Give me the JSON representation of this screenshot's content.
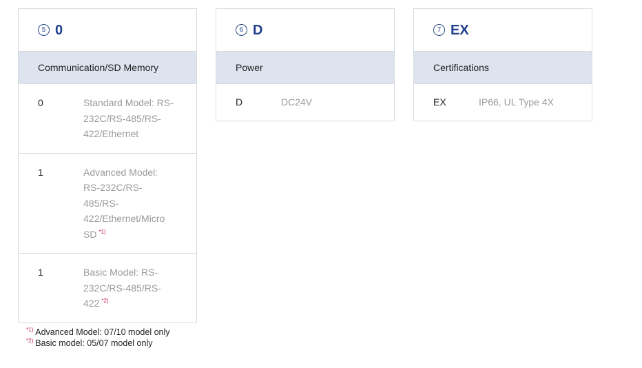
{
  "cards": [
    {
      "number": "5",
      "code": "0",
      "category": "Communication/SD Memory",
      "rows": [
        {
          "code": "0",
          "desc": "Standard Model: RS-232C/RS-485/RS-422/Ethernet",
          "note": ""
        },
        {
          "code": "1",
          "desc": "Advanced Model: RS-232C/RS-485/RS-422/Ethernet/Micro SD",
          "note": "*1)"
        },
        {
          "code": "1",
          "desc": "Basic Model: RS-232C/RS-485/RS-422",
          "note": "*2)"
        }
      ]
    },
    {
      "number": "6",
      "code": "D",
      "category": "Power",
      "rows": [
        {
          "code": "D",
          "desc": "DC24V",
          "note": ""
        }
      ]
    },
    {
      "number": "7",
      "code": "EX",
      "category": "Certifications",
      "rows": [
        {
          "code": "EX",
          "desc": "IP66, UL Type 4X",
          "note": ""
        }
      ]
    }
  ],
  "footnotes": [
    {
      "mark": "*1)",
      "text": "Advanced Model: 07/10 model only"
    },
    {
      "mark": "*2)",
      "text": "Basic model: 05/07 model only"
    }
  ],
  "colors": {
    "accent": "#1f3f8f",
    "header_bg": "#dde4ef",
    "note_mark": "#c2185b"
  }
}
